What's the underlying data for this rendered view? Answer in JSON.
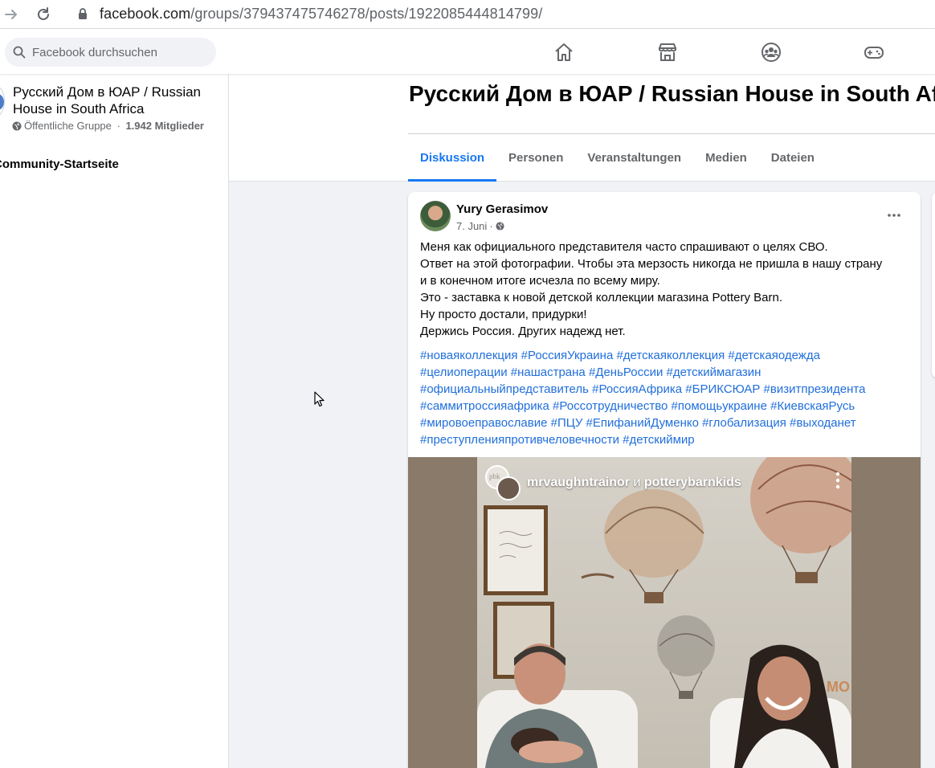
{
  "browser": {
    "url_host": "facebook.com",
    "url_path": "/groups/379437475746278/posts/1922085444814799/"
  },
  "topnav": {
    "search_placeholder": "Facebook durchsuchen"
  },
  "sidebar": {
    "group_name": "Русский Дом в ЮАР / Russian House in South Africa",
    "group_type": "Öffentliche Gruppe",
    "separator": " · ",
    "member_count": "1.942 Mitglieder",
    "community_link": "Community-Startseite"
  },
  "header": {
    "title": "Русский Дом в ЮАР / Russian House in South Africa",
    "tabs": [
      {
        "label": "Diskussion",
        "active": true
      },
      {
        "label": "Personen",
        "active": false
      },
      {
        "label": "Veranstaltungen",
        "active": false
      },
      {
        "label": "Medien",
        "active": false
      },
      {
        "label": "Dateien",
        "active": false
      }
    ]
  },
  "post": {
    "author": "Yury Gerasimov",
    "date": "7. Juni",
    "date_separator": "·",
    "body_lines": [
      "Меня как официального представителя часто спрашивают о целях СВО.",
      "Ответ на этой фотографии. Чтобы эта мерзость никогда не пришла в нашу страну",
      "и в конечном итоге исчезла по всему миру.",
      "Это - заставка к новой детской коллекции магазина Pottery Barn.",
      "Ну просто достали, придурки!",
      "Держись Россия. Других надежд нет."
    ],
    "hashtag_lines": [
      "#новаяколлекция #РоссияУкраина #детскаяколлекция #детскаяодежда",
      "#целиоперации #нашастрана #ДеньРоссии #детскиймагазин",
      "#официальныйпредставитель #РоссияАфрика #БРИКСЮАР #визитпрезидента",
      "#саммитроссияафрика #Россотрудничество #помощьукраине #КиевскаяРусь",
      "#мировоеправославие #ПЦУ #ЕпифанийДуменко #глобализация #выходанет",
      "#преступленияпротивчеловечности #детскиймир"
    ],
    "media": {
      "story_user1": "mrvaughntrainor",
      "story_and": " и ",
      "story_user2": "potterybarnkids",
      "av1_label": "pbk",
      "sign": "MO"
    }
  },
  "colors": {
    "accent": "#1877f2",
    "hashtag": "#216fdb",
    "secondary_text": "#65676b",
    "background": "#f0f2f5"
  }
}
